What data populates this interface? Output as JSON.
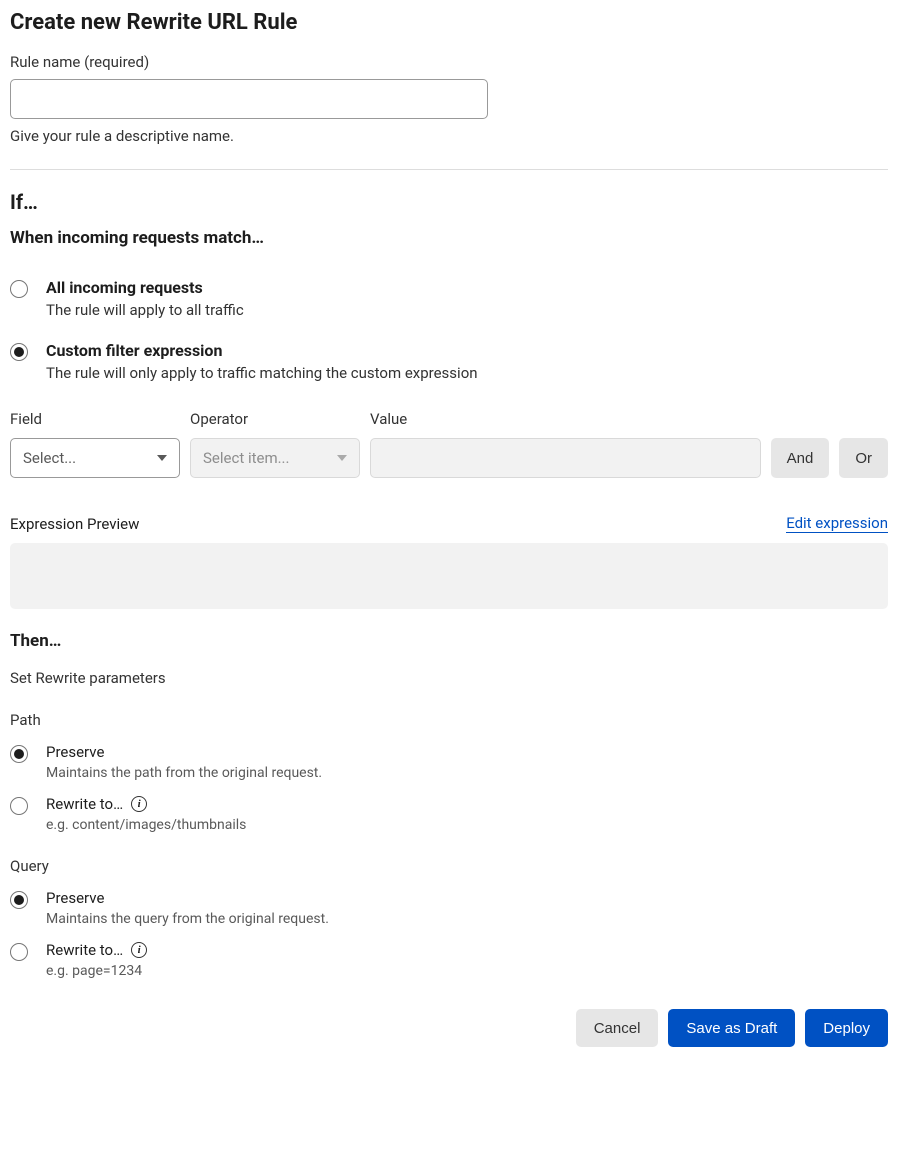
{
  "header": {
    "title": "Create new Rewrite URL Rule"
  },
  "rule_name": {
    "label": "Rule name (required)",
    "value": "",
    "help": "Give your rule a descriptive name."
  },
  "if_section": {
    "heading": "If…",
    "subheading": "When incoming requests match…",
    "options": {
      "all": {
        "title": "All incoming requests",
        "desc": "The rule will apply to all traffic"
      },
      "custom": {
        "title": "Custom filter expression",
        "desc": "The rule will only apply to traffic matching the custom expression"
      }
    }
  },
  "filter": {
    "field_label": "Field",
    "field_placeholder": "Select...",
    "operator_label": "Operator",
    "operator_placeholder": "Select item...",
    "value_label": "Value",
    "and_label": "And",
    "or_label": "Or"
  },
  "preview": {
    "label": "Expression Preview",
    "edit_link": "Edit expression"
  },
  "then_section": {
    "heading": "Then…",
    "subheading": "Set Rewrite parameters",
    "path": {
      "label": "Path",
      "preserve": {
        "title": "Preserve",
        "desc": "Maintains the path from the original request."
      },
      "rewrite": {
        "title": "Rewrite to…",
        "desc": "e.g. content/images/thumbnails"
      }
    },
    "query": {
      "label": "Query",
      "preserve": {
        "title": "Preserve",
        "desc": "Maintains the query from the original request."
      },
      "rewrite": {
        "title": "Rewrite to…",
        "desc": "e.g. page=1234"
      }
    }
  },
  "footer": {
    "cancel": "Cancel",
    "save_draft": "Save as Draft",
    "deploy": "Deploy"
  }
}
